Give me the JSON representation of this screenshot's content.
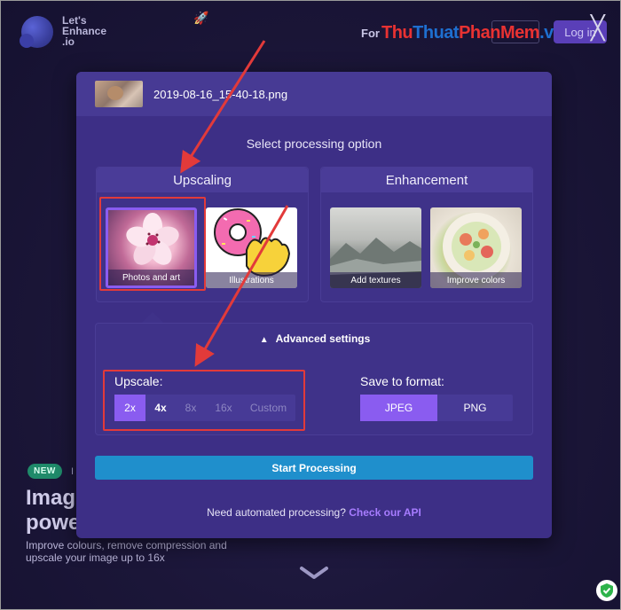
{
  "background": {
    "logo_text": "Let's\nEnhance\n.io",
    "for_text": "For",
    "watermark": [
      "Thu",
      "Thuat",
      "PhanMem",
      ".vn"
    ],
    "login_label": "Log in",
    "close_glyph": "╳",
    "new_badge": "NEW",
    "new_text": "I",
    "hero_title": "Imag\npowe",
    "hero_subtitle": "Improve colours, remove compression and\nupscale your image up to 16x"
  },
  "modal": {
    "filename": "2019-08-16_15-40-18.png",
    "select_title": "Select processing option",
    "upscaling": {
      "title": "Upscaling",
      "options": [
        {
          "label": "Photos and art",
          "selected": true
        },
        {
          "label": "Illustrations",
          "selected": false
        }
      ]
    },
    "enhancement": {
      "title": "Enhancement",
      "options": [
        {
          "label": "Add textures"
        },
        {
          "label": "Improve colors"
        }
      ]
    },
    "advanced": {
      "title": "Advanced settings",
      "upscale_label": "Upscale:",
      "upscale_options": [
        "2x",
        "4x",
        "8x",
        "16x",
        "Custom"
      ],
      "upscale_selected": "2x",
      "format_label": "Save to format:",
      "format_options": [
        "JPEG",
        "PNG"
      ],
      "format_selected": "JPEG"
    },
    "start_label": "Start Processing",
    "api_prompt": "Need automated processing?",
    "api_link": "Check our API"
  },
  "colors": {
    "accent": "#8a5cf0",
    "highlight": "#e23a3a",
    "start_button": "#1f8fcc"
  }
}
